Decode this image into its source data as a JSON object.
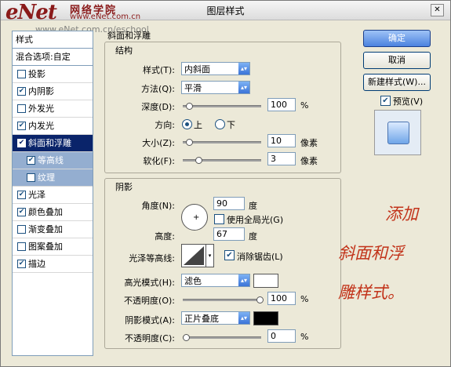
{
  "window": {
    "title": "图层样式",
    "logo": "eNet",
    "logo_cn": "网络学院",
    "logo_url": "www.eNet.com.cn",
    "watermark": "www.eNet.com.cn/eschool"
  },
  "style_list": {
    "header": "样式",
    "items": [
      {
        "label": "混合选项:自定",
        "type": "plain"
      },
      {
        "label": "投影",
        "checked": false
      },
      {
        "label": "内阴影",
        "checked": true
      },
      {
        "label": "外发光",
        "checked": false
      },
      {
        "label": "内发光",
        "checked": true
      },
      {
        "label": "斜面和浮雕",
        "checked": true,
        "selected": true
      },
      {
        "label": "等高线",
        "checked": true,
        "sub": true
      },
      {
        "label": "纹理",
        "checked": false,
        "sub": true
      },
      {
        "label": "光泽",
        "checked": true
      },
      {
        "label": "颜色叠加",
        "checked": true
      },
      {
        "label": "渐变叠加",
        "checked": false
      },
      {
        "label": "图案叠加",
        "checked": false
      },
      {
        "label": "描边",
        "checked": true
      }
    ]
  },
  "bevel": {
    "section_title": "斜面和浮雕",
    "structure_title": "结构",
    "style_label": "样式(T):",
    "style_value": "内斜面",
    "technique_label": "方法(Q):",
    "technique_value": "平滑",
    "depth_label": "深度(D):",
    "depth_value": "100",
    "depth_unit": "%",
    "direction_label": "方向:",
    "direction_up": "上",
    "direction_down": "下",
    "size_label": "大小(Z):",
    "size_value": "10",
    "size_unit": "像素",
    "soften_label": "软化(F):",
    "soften_value": "3",
    "soften_unit": "像素"
  },
  "shading": {
    "title": "阴影",
    "angle_label": "角度(N):",
    "angle_value": "90",
    "angle_unit": "度",
    "global_light_label": "使用全局光(G)",
    "altitude_label": "高度:",
    "altitude_value": "67",
    "altitude_unit": "度",
    "gloss_contour_label": "光泽等高线:",
    "antialias_label": "消除锯齿(L)",
    "highlight_mode_label": "高光模式(H):",
    "highlight_mode_value": "滤色",
    "highlight_color": "#ffffff",
    "highlight_opacity_label": "不透明度(O):",
    "highlight_opacity_value": "100",
    "shadow_mode_label": "阴影模式(A):",
    "shadow_mode_value": "正片叠底",
    "shadow_color": "#000000",
    "shadow_opacity_label": "不透明度(C):",
    "shadow_opacity_value": "0",
    "percent": "%"
  },
  "buttons": {
    "ok": "确定",
    "cancel": "取消",
    "new_style": "新建样式(W)...",
    "preview": "预览(V)"
  },
  "annotation": {
    "line1": "添加",
    "line2": "斜面和浮",
    "line3": "雕样式。"
  }
}
